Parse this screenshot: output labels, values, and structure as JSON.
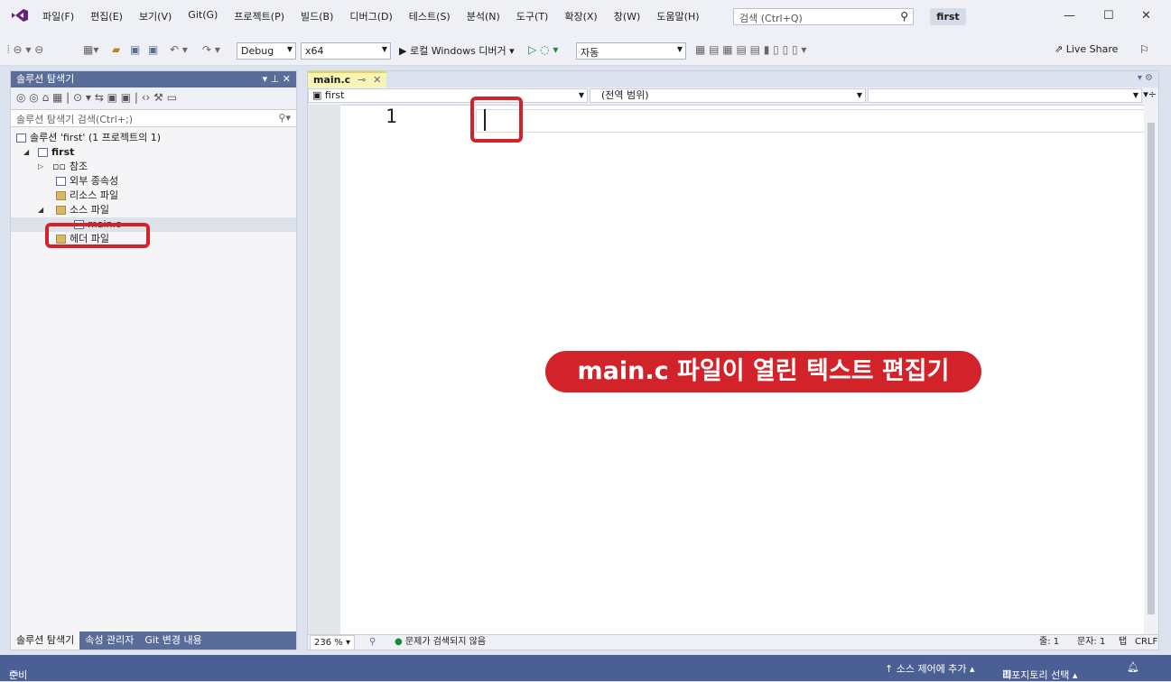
{
  "menu": {
    "items": [
      "파일(F)",
      "편집(E)",
      "보기(V)",
      "Git(G)",
      "프로젝트(P)",
      "빌드(B)",
      "디버그(D)",
      "테스트(S)",
      "분석(N)",
      "도구(T)",
      "확장(X)",
      "창(W)",
      "도움말(H)"
    ],
    "search_placeholder": "검색 (Ctrl+Q)",
    "solution_name": "first"
  },
  "toolbar": {
    "config": "Debug",
    "platform": "x64",
    "run_label": "▶ 로컬 Windows 디버거 ▾",
    "auto_combo": "자동",
    "live_share": "Live Share"
  },
  "solution_explorer": {
    "title": "솔루션 탐색기",
    "search_placeholder": "솔루션 탐색기 검색(Ctrl+;)",
    "tree": [
      {
        "label": "솔루션 'first' (1 프로젝트의 1)"
      },
      {
        "label": "first"
      },
      {
        "label": "참조"
      },
      {
        "label": "외부 종속성"
      },
      {
        "label": "리소스 파일"
      },
      {
        "label": "소스 파일"
      },
      {
        "label": "main.c"
      },
      {
        "label": "헤더 파일"
      }
    ],
    "bottom_tabs": [
      "솔루션 탐색기",
      "속성 관리자",
      "Git 변경 내용"
    ]
  },
  "editor": {
    "tab_label": "main.c",
    "nav_project": "first",
    "nav_scope": "(전역 범위)",
    "line_number": "1",
    "zoom": "236 %",
    "issues": "문제가 검색되지 않음",
    "line_info": "줄: 1",
    "col_info": "문자: 1",
    "tab_info": "탭",
    "eol_info": "CRLF"
  },
  "callout": {
    "text": "main.c 파일이 열린 텍스트 편집기"
  },
  "status": {
    "ready": "준비",
    "source_control": "↑ 소스 제어에 추가 ▴",
    "repo_select": "리포지토리 선택 ▴"
  },
  "colors": {
    "accent": "#5a6d99",
    "callout_red": "#d2232a",
    "status_bar": "#4a5f94"
  }
}
